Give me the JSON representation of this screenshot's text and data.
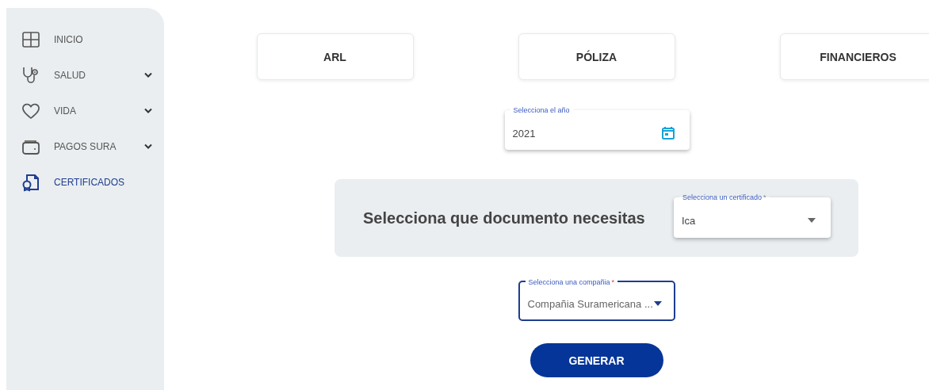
{
  "sidebar": {
    "items": [
      {
        "label": "INICIO",
        "kind": "link",
        "selected": false
      },
      {
        "label": "SALUD",
        "kind": "group",
        "selected": false
      },
      {
        "label": "VIDA",
        "kind": "group",
        "selected": false
      },
      {
        "label": "PAGOS SURA",
        "kind": "group",
        "selected": false
      },
      {
        "label": "CERTIFICADOS",
        "kind": "link",
        "selected": true
      }
    ]
  },
  "categories": [
    {
      "label": "ARL"
    },
    {
      "label": "PÓLIZA"
    },
    {
      "label": "FINANCIEROS"
    }
  ],
  "year_field": {
    "label": "Selecciona el año",
    "value": "2021"
  },
  "document_panel": {
    "title": "Selecciona que documento necesitas",
    "certificate_select": {
      "label": "Selecciona un certificado",
      "required_mark": "*",
      "value": "Ica",
      "focused": false
    }
  },
  "company_select": {
    "label": "Selecciona una compañia",
    "required_mark": "*",
    "value": "Compañia Suramericana ...",
    "focused": true
  },
  "generate_button": {
    "label": "GENERAR"
  }
}
